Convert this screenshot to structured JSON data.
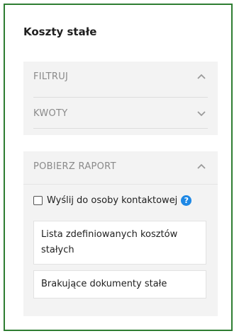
{
  "page": {
    "title": "Koszty stałe"
  },
  "sections": [
    {
      "label": "FILTRUJ",
      "state": "expanded",
      "chevron": "chevron-up-icon"
    },
    {
      "label": "KWOTY",
      "state": "collapsed",
      "chevron": "chevron-down-icon"
    }
  ],
  "report": {
    "label": "POBIERZ RAPORT",
    "chevron": "chevron-up-icon",
    "send_to_contact_label": "Wyślij do osoby kontaktowej",
    "send_to_contact_checked": false,
    "help_icon": "?",
    "buttons": [
      {
        "label": "Lista zdefiniowanych kosztów stałych"
      },
      {
        "label": "Brakujące dokumenty stałe"
      }
    ]
  },
  "colors": {
    "frame_border": "#2e7d32",
    "help_icon": "#1e88e5",
    "panel_bg": "#f3f3f3"
  }
}
